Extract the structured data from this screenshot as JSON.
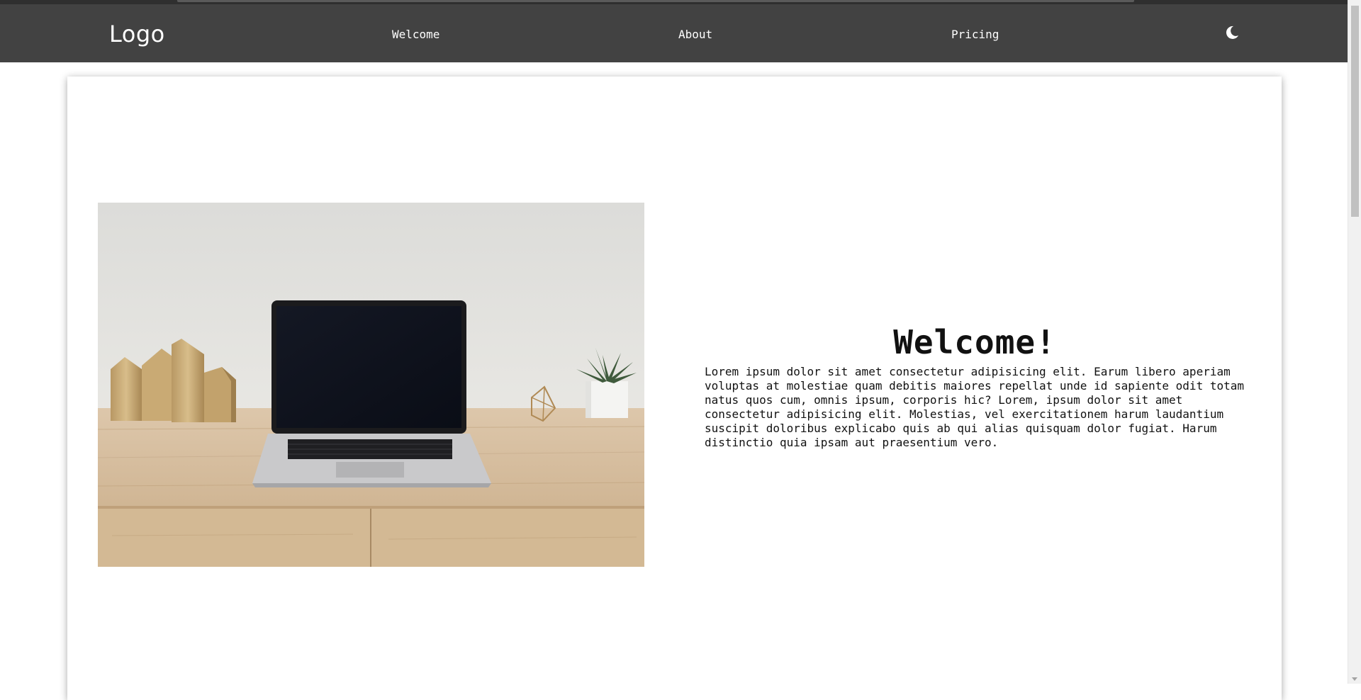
{
  "navbar": {
    "logo": "Logo",
    "links": [
      {
        "label": "Welcome"
      },
      {
        "label": "About"
      },
      {
        "label": "Pricing"
      }
    ],
    "theme_toggle_icon": "moon-icon",
    "background": "#424242"
  },
  "hero": {
    "title": "Welcome!",
    "paragraph": "Lorem ipsum dolor sit amet consectetur adipisicing elit. Earum libero aperiam voluptas at molestiae quam debitis maiores repellat unde id sapiente odit totam natus quos cum, omnis ipsum, corporis hic? Lorem, ipsum dolor sit amet consectetur adipisicing elit. Molestias, vel exercitationem harum laudantium suscipit doloribus explicabo quis ab qui alias quisquam dolor fugiat. Harum distinctio quia ipsam aut praesentium vero."
  }
}
